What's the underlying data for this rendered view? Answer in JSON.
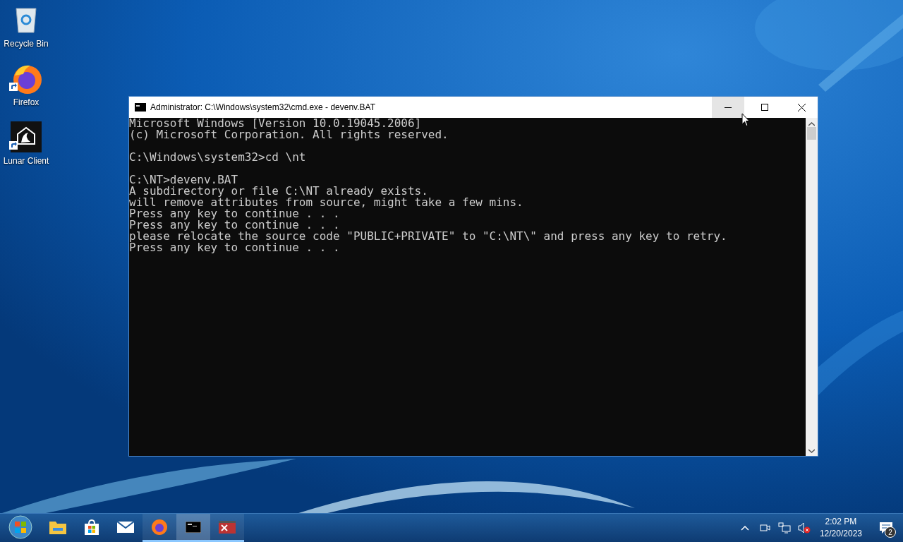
{
  "desktop_icons": [
    {
      "kind": "recycle",
      "label": "Recycle Bin",
      "shortcut": false
    },
    {
      "kind": "firefox",
      "label": "Firefox",
      "shortcut": true
    },
    {
      "kind": "lunar",
      "label": "Lunar Client",
      "shortcut": true
    }
  ],
  "window": {
    "title": "Administrator: C:\\Windows\\system32\\cmd.exe - devenv.BAT",
    "controls": [
      {
        "kind": "minimize",
        "hovered": true
      },
      {
        "kind": "maximize",
        "hovered": false
      },
      {
        "kind": "close",
        "hovered": false
      }
    ],
    "console_blocks": [
      [
        "Microsoft Windows [Version 10.0.19045.2006]",
        "(c) Microsoft Corporation. All rights reserved."
      ],
      [
        "C:\\Windows\\system32>cd \\nt"
      ],
      [
        "C:\\NT>devenv.BAT",
        "A subdirectory or file C:\\NT already exists.",
        "will remove attributes from source, might take a few mins.",
        "Press any key to continue . . .",
        "Press any key to continue . . .",
        "please relocate the source code \"PUBLIC+PRIVATE\" to \"C:\\NT\\\" and press any key to retry.",
        "Press any key to continue . . ."
      ]
    ]
  },
  "taskbar": {
    "items": [
      {
        "kind": "start",
        "running": false,
        "selected": false
      },
      {
        "kind": "explorer",
        "running": false,
        "selected": false
      },
      {
        "kind": "store",
        "running": false,
        "selected": false
      },
      {
        "kind": "mail",
        "running": false,
        "selected": false
      },
      {
        "kind": "firefox",
        "running": true,
        "selected": false
      },
      {
        "kind": "console",
        "running": true,
        "selected": true
      },
      {
        "kind": "redapp",
        "running": true,
        "selected": false
      }
    ],
    "tray": {
      "time": "2:02 PM",
      "date": "12/20/2023",
      "notifications": "2"
    }
  }
}
